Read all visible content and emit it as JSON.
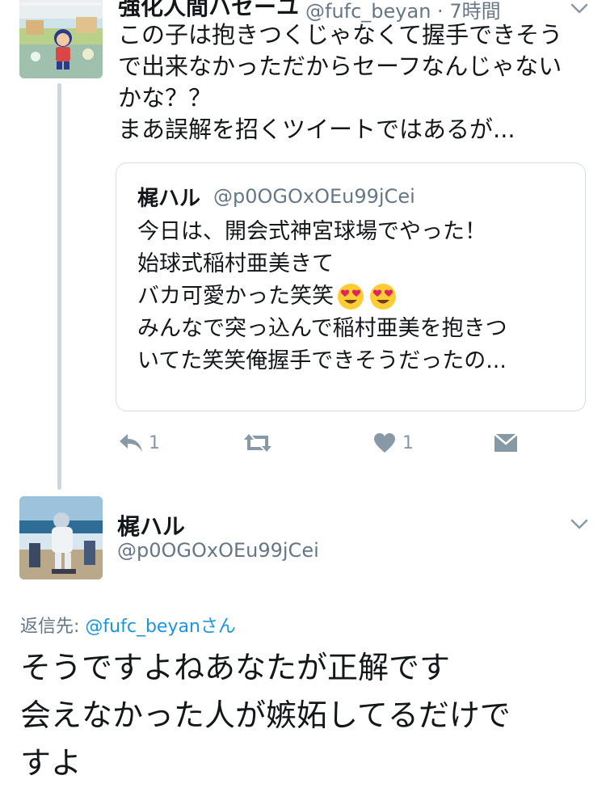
{
  "tweet1": {
    "name": "強化人間ハセーユ",
    "handle_time": "@fufc_beyan · 7時間",
    "text_lines": [
      "この子は抱きつくじゃなくて握手できそう",
      "で出来なかっただからセーフなんじゃない",
      "かな？？",
      "まあ誤解を招くツイートではあるが..."
    ],
    "quoted": {
      "name": "梶ハル",
      "handle": "@p0OGOxOEu99jCei",
      "lines": [
        "今日は、開会式神宮球場でやった！",
        "始球式稲村亜美きて",
        "バカ可愛かった笑笑",
        "みんなで突っ込んで稲村亜美を抱きつ",
        "いてた笑笑俺握手できそうだったの..."
      ]
    },
    "actions": {
      "reply_count": "1",
      "like_count": "1"
    }
  },
  "tweet2": {
    "name": "梶ハル",
    "handle": "@p0OGOxOEu99jCei",
    "reply_prefix": "返信先:",
    "reply_target": "@fufc_beyan",
    "reply_suffix": "さん",
    "text_lines": [
      "そうですよねあなたが正解です",
      "会えなかった人が嫉妬してるだけで",
      "すよ"
    ]
  },
  "colors": {
    "text": "#14171a",
    "muted": "#657786",
    "icon": "#8899a6",
    "link": "#1b95e0",
    "border": "#d6dde3"
  }
}
